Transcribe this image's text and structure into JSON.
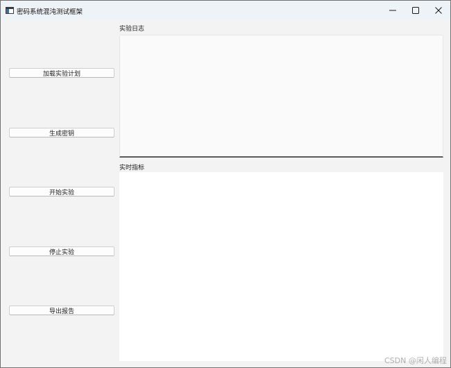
{
  "window": {
    "title": "密码系统混沌测试框架",
    "app_icon": "app-window-icon",
    "controls": [
      "minimize-icon",
      "maximize-icon",
      "close-icon"
    ]
  },
  "sidebar": {
    "buttons": [
      {
        "label": "加载实验计划"
      },
      {
        "label": "生成密钥"
      },
      {
        "label": "开始实验"
      },
      {
        "label": "停止实验"
      },
      {
        "label": "导出报告"
      }
    ]
  },
  "log_panel": {
    "label": "实验日志",
    "content": ""
  },
  "metrics_panel": {
    "label": "实时指标"
  },
  "watermark": {
    "text": "CSDN @闲人编程"
  },
  "colors": {
    "window_bg": "#f3f3f3",
    "titlebar_bg": "#eef3f8",
    "button_bg": "#fdfdfd",
    "panel_bg": "#ffffff"
  }
}
